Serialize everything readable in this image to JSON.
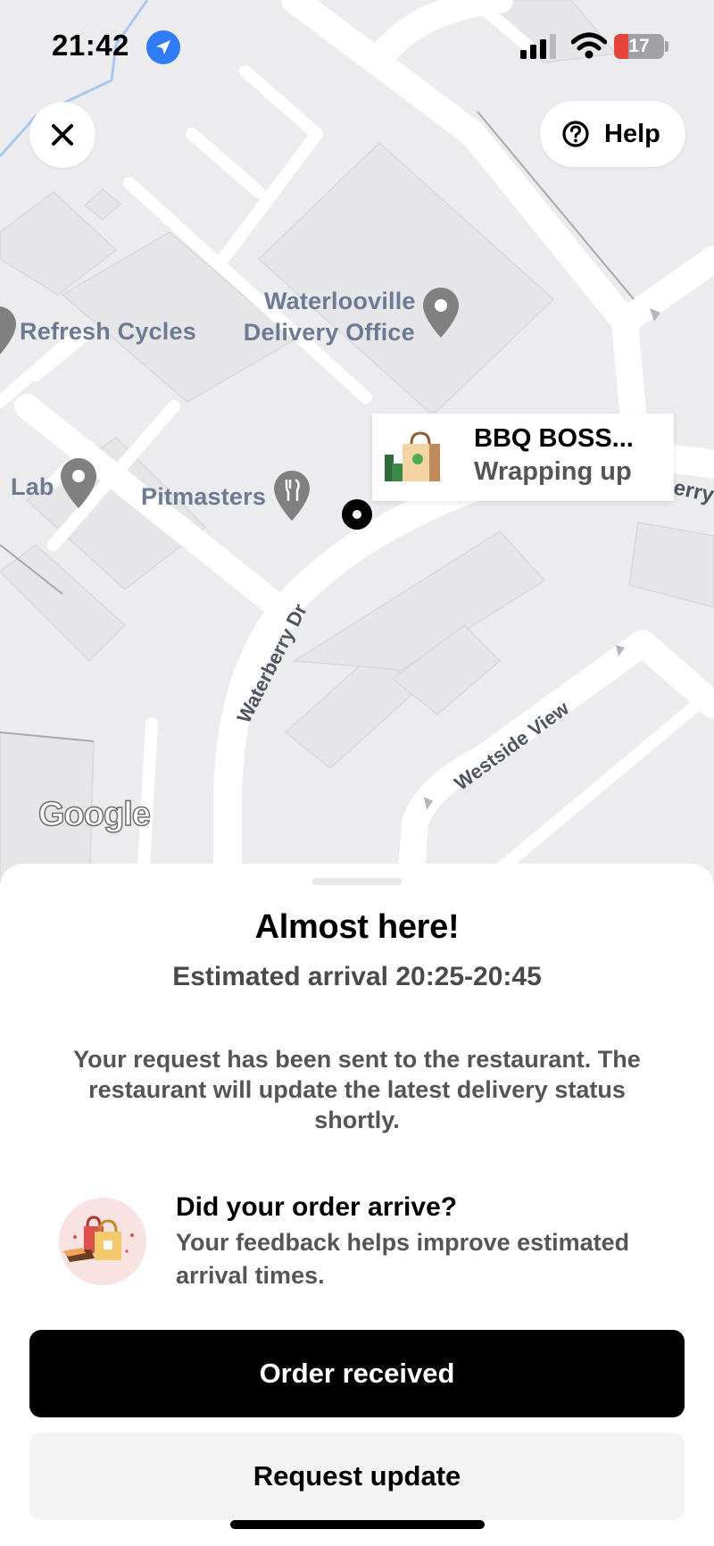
{
  "status_bar": {
    "time": "21:42",
    "battery_level": "17",
    "icons": [
      "location-arrow-icon",
      "cellular-signal-icon",
      "wifi-icon",
      "battery-charging-icon"
    ]
  },
  "map": {
    "close_icon": "close-icon",
    "help_label": "Help",
    "help_icon": "question-circle-icon",
    "labels": {
      "refresh_cycles": "Refresh Cycles",
      "delivery_office_line1": "Waterlooville",
      "delivery_office_line2": "Delivery Office",
      "lab": "Lab",
      "pitmasters": "Pitmasters",
      "waterberry_dr": "Waterberry Dr",
      "westside_view": "Westside View",
      "errry": "erry"
    },
    "restaurant_card": {
      "name": "BBQ BOSS...",
      "status": "Wrapping up",
      "icon": "shopping-bag-icon"
    },
    "attribution": "Google",
    "colors": {
      "map_background": "#ececee",
      "road": "#ffffff",
      "label_text": "#6c7a93",
      "pin": "#808080"
    }
  },
  "sheet": {
    "title": "Almost here!",
    "eta": "Estimated arrival 20:25-20:45",
    "message": "Your request has been sent to the restaurant. The restaurant will update the latest delivery status shortly.",
    "feedback": {
      "icon": "shopping-bags-icon",
      "title": "Did your order arrive?",
      "description": "Your feedback helps improve estimated arrival times."
    },
    "primary_button": "Order received",
    "secondary_button": "Request update"
  }
}
